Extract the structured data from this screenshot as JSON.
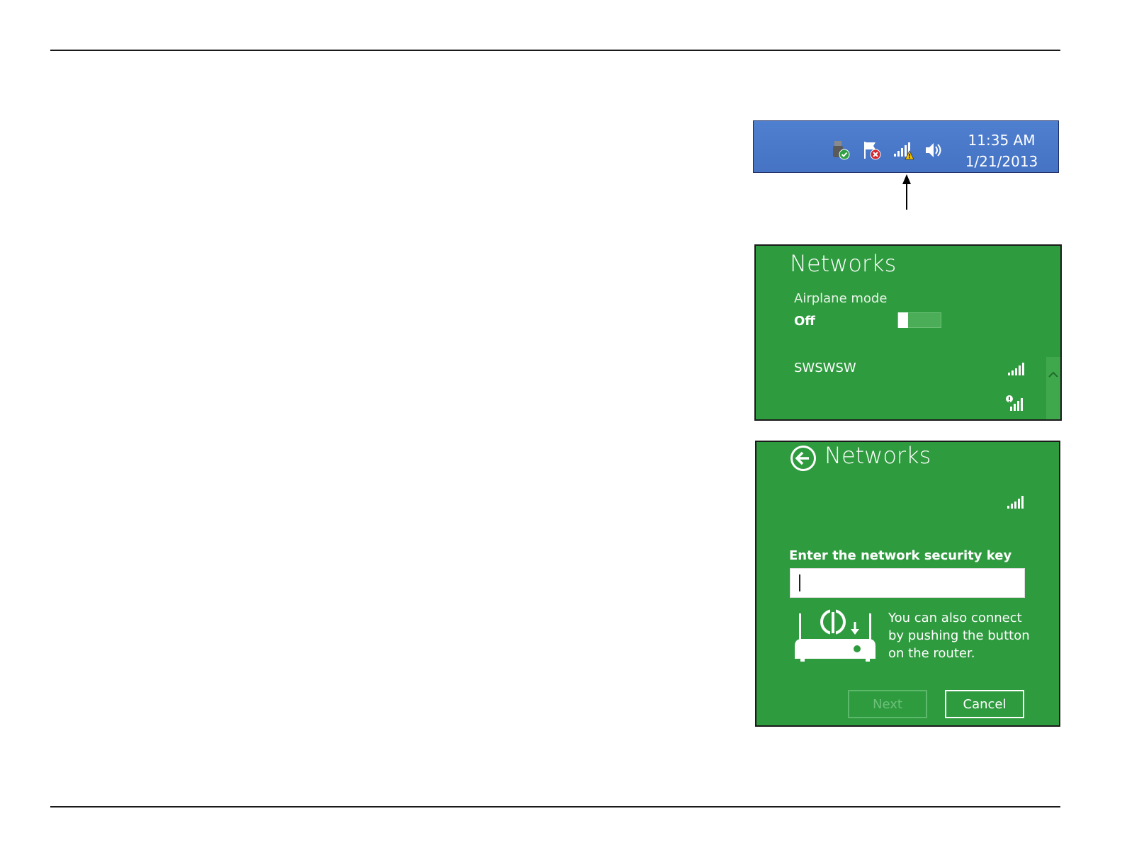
{
  "taskbar": {
    "time": "11:35 AM",
    "date": "1/21/2013",
    "icons": [
      "usb-safe-remove-icon",
      "action-center-flag-icon",
      "network-warning-icon",
      "speaker-icon"
    ]
  },
  "networks_panel": {
    "title": "Networks",
    "airplane_mode_label": "Airplane mode",
    "airplane_mode_state": "Off",
    "network_name": "SWSWSW"
  },
  "connect_panel": {
    "title": "Networks",
    "security_key_label": "Enter the network security key",
    "security_key_value": "",
    "wps_hint": "You can also connect by pushing the button on the router.",
    "next_label": "Next",
    "cancel_label": "Cancel"
  },
  "colors": {
    "taskbar_blue": "#4673c4",
    "panel_green": "#2f9b3f"
  }
}
